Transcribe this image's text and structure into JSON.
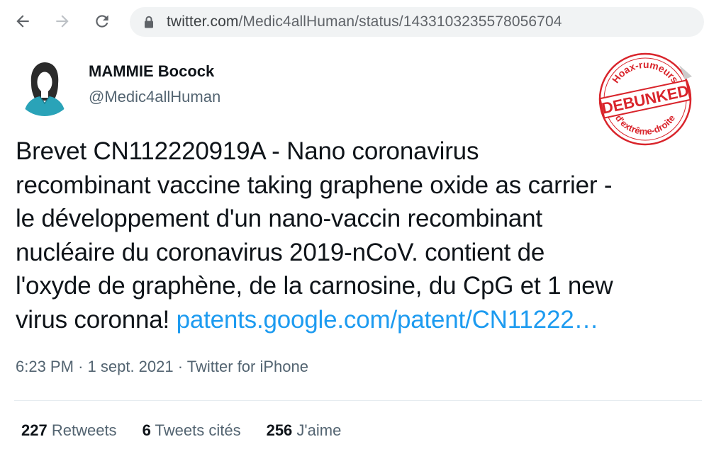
{
  "browser": {
    "url_domain": "twitter.com",
    "url_path": "/Medic4allHuman/status/1433103235578056704"
  },
  "tweet": {
    "display_name": "MAMMIE Bocock",
    "handle": "@Medic4allHuman",
    "text_lines": [
      "Brevet CN112220919A - Nano coronavirus",
      "recombinant vaccine taking graphene oxide as carrier -",
      "le développement d'un nano-vaccin recombinant",
      "nucléaire du coronavirus 2019-nCoV. contient de",
      "l'oxyde de graphène, de la carnosine, du CpG et 1 new",
      "virus coronna!"
    ],
    "link_text": "patents.google.com/patent/CN11222…",
    "time": "6:23 PM",
    "date": "1 sept. 2021",
    "source": "Twitter for iPhone",
    "separator": "·",
    "stats": {
      "retweets_count": "227",
      "retweets_label": "Retweets",
      "quotes_count": "6",
      "quotes_label": "Tweets cités",
      "likes_count": "256",
      "likes_label": "J'aime"
    }
  },
  "stamp": {
    "top_text": "Hoax-rumeurs",
    "main_text": "DEBUNKED",
    "bottom_text": "d'extrême-droite",
    "color": "#d9242b"
  },
  "colors": {
    "link": "#1d9bf0",
    "text": "#0f1419",
    "secondary": "#536471",
    "avatar_teal": "#2aa3b8"
  },
  "icons": {
    "back": "arrow-left-icon",
    "forward": "arrow-right-icon",
    "reload": "reload-icon",
    "lock": "lock-icon"
  }
}
